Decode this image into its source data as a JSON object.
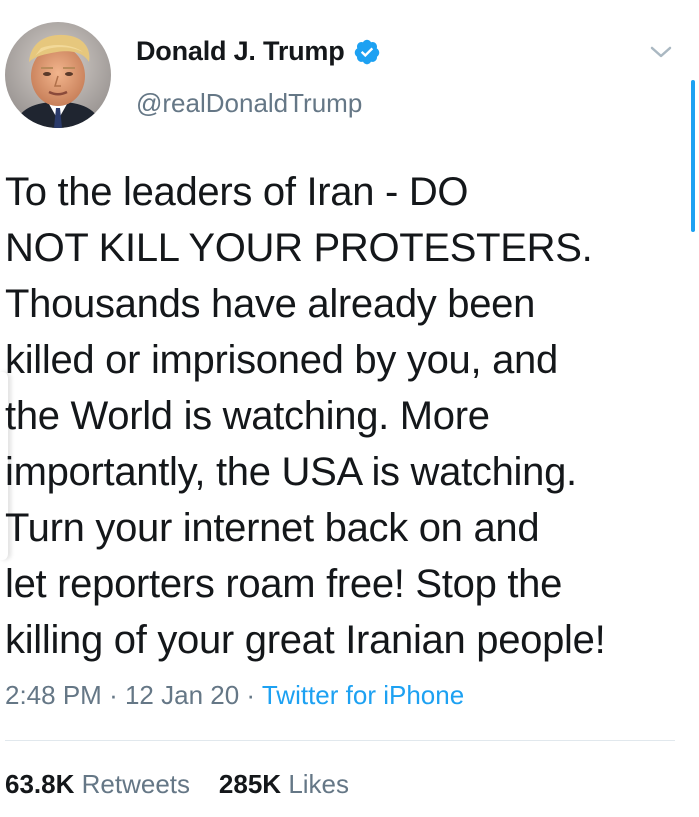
{
  "user": {
    "display_name": "Donald J. Trump",
    "handle": "@realDonaldTrump",
    "verified_icon": "verified-badge-icon",
    "avatar_icon": "profile-avatar"
  },
  "menu": {
    "icon": "chevron-down-icon"
  },
  "tweet": {
    "text": "To the leaders of Iran - DO\nNOT KILL YOUR PROTESTERS.\nThousands have already been\nkilled or imprisoned by you, and\nthe World is watching. More\nimportantly, the USA is watching.\nTurn your internet back on and\nlet reporters roam free! Stop the\nkilling of your great Iranian people!",
    "time": "2:48 PM",
    "date": "12 Jan 20",
    "separator": "·",
    "source": "Twitter for iPhone"
  },
  "stats": {
    "retweets_count": "63.8K",
    "retweets_label": "Retweets",
    "likes_count": "285K",
    "likes_label": "Likes"
  },
  "colors": {
    "accent": "#1da1f2",
    "text": "#14171a",
    "secondary": "#657786"
  }
}
